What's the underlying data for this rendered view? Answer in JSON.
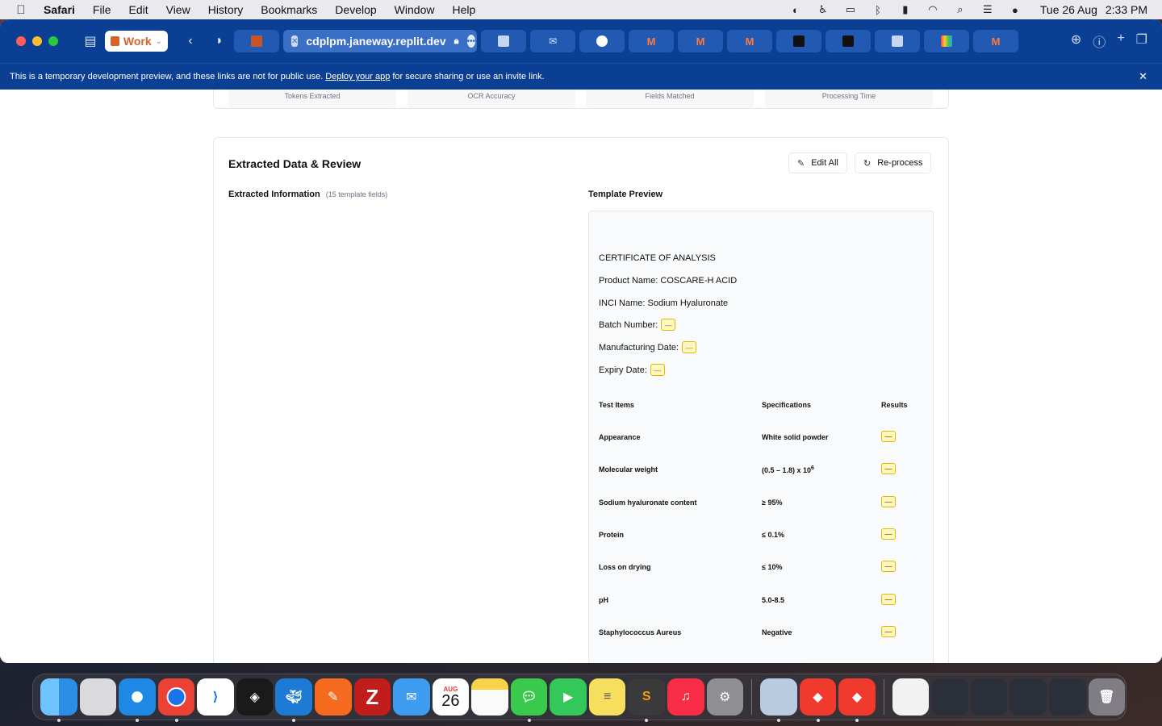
{
  "menubar": {
    "app_name": "Safari",
    "menus": [
      "File",
      "Edit",
      "View",
      "History",
      "Bookmarks",
      "Develop",
      "Window",
      "Help"
    ],
    "date": "Tue 26 Aug",
    "time": "2:33 PM"
  },
  "browser": {
    "profile": "Work",
    "url": "cdplpm.janeway.replit.dev",
    "banner_text_before": "This is a temporary development preview, and these links are not for public use.",
    "banner_link": "Deploy your app",
    "banner_text_after": "for secure sharing or use an invite link.",
    "tab_icons": [
      "replit-icon",
      "docs-icon",
      "mail-icon",
      "github-icon",
      "m-icon",
      "m-icon",
      "m-icon",
      "cube-icon",
      "cube-icon",
      "docs-icon",
      "grid-icon",
      "m-icon"
    ]
  },
  "stats": {
    "labels": [
      "Tokens Extracted",
      "OCR Accuracy",
      "Fields Matched",
      "Processing Time"
    ]
  },
  "review": {
    "title": "Extracted Data & Review",
    "edit_all": "Edit All",
    "reprocess": "Re-process",
    "extracted_label": "Extracted Information",
    "extracted_count": "(15 template fields)",
    "preview_label": "Template Preview"
  },
  "template": {
    "heading": "CERTIFICATE OF ANALYSIS",
    "product_name": "Product Name: COSCARE-H ACID",
    "inci_name": "INCI Name: Sodium Hyaluronate",
    "batch_label": "Batch Number:",
    "mfg_label": "Manufacturing Date:",
    "expiry_label": "Expiry Date:",
    "blank": "—",
    "columns": [
      "Test Items",
      "Specifications",
      "Results"
    ],
    "rows": [
      {
        "item": "Appearance",
        "spec": "White solid powder"
      },
      {
        "item": "Molecular weight",
        "spec": "(0.5 – 1.8) x 10",
        "sup": "6"
      },
      {
        "item": "Sodium hyaluronate content",
        "spec": "≥ 95%"
      },
      {
        "item": "Protein",
        "spec": "≤ 0.1%"
      },
      {
        "item": "Loss on drying",
        "spec": "≤ 10%"
      },
      {
        "item": "pH",
        "spec": "5.0-8.5"
      },
      {
        "item": "Staphylococcus Aureus",
        "spec": "Negative"
      }
    ]
  },
  "dock": {
    "calendar_month": "AUG",
    "calendar_day": "26",
    "apps": [
      "finder-icon",
      "launchpad-icon",
      "safari-icon",
      "chrome-icon",
      "vscode-icon",
      "cube-icon",
      "docker-icon",
      "pen-icon",
      "filezilla-icon",
      "mail-icon",
      "calendar-icon",
      "notes-icon",
      "messages-icon",
      "facetime-icon",
      "stickies-icon",
      "sublime-icon",
      "music-icon",
      "settings-icon",
      "preview-icon",
      "anydesk-icon",
      "anydesk-user-icon",
      "document-icon",
      "window-thumb",
      "window-thumb",
      "window-thumb",
      "window-thumb",
      "trash-icon"
    ]
  }
}
